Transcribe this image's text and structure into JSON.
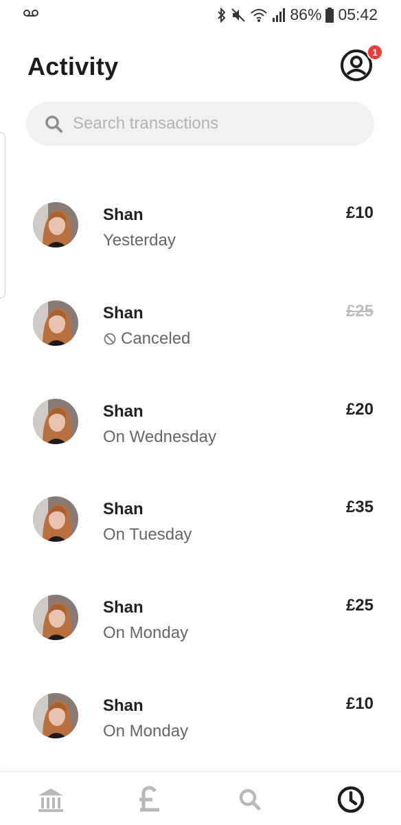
{
  "status_bar": {
    "left_icon": "voicemail-icon",
    "battery": "86%",
    "time": "05:42",
    "icons": [
      "bluetooth-icon",
      "mute-icon",
      "wifi-icon",
      "signal-icon",
      "battery-icon"
    ]
  },
  "header": {
    "title": "Activity",
    "profile_icon": "profile-icon",
    "notification_count": "1",
    "badge_color": "#ee3b3b"
  },
  "search": {
    "placeholder": "Search transactions",
    "value": ""
  },
  "transactions": [
    {
      "name": "Shan",
      "subtitle": "Yesterday",
      "amount": "£10",
      "canceled": false
    },
    {
      "name": "Shan",
      "subtitle": "Canceled",
      "amount": "£25",
      "canceled": true
    },
    {
      "name": "Shan",
      "subtitle": "On Wednesday",
      "amount": "£20",
      "canceled": false
    },
    {
      "name": "Shan",
      "subtitle": "On Tuesday",
      "amount": "£35",
      "canceled": false
    },
    {
      "name": "Shan",
      "subtitle": "On Monday",
      "amount": "£25",
      "canceled": false
    },
    {
      "name": "Shan",
      "subtitle": "On Monday",
      "amount": "£10",
      "canceled": false
    }
  ],
  "bottom_nav": [
    {
      "icon": "bank-icon",
      "active": false
    },
    {
      "icon": "pound-icon",
      "active": false
    },
    {
      "icon": "search-icon",
      "active": false
    },
    {
      "icon": "clock-icon",
      "active": true
    }
  ],
  "colors": {
    "text_primary": "#222222",
    "text_secondary": "#666666",
    "inactive_icon": "#b8b8b8",
    "active_icon": "#1d1d1d"
  }
}
